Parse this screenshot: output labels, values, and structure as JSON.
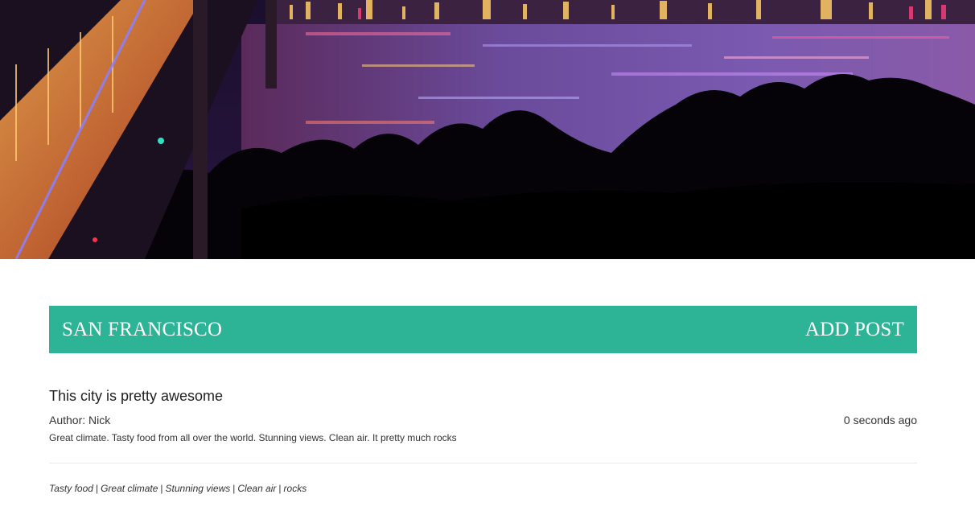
{
  "header": {
    "city": "SAN FRANCISCO",
    "add_post_label": "ADD POST",
    "accent_color": "#2db396"
  },
  "post": {
    "title": "This city is pretty awesome",
    "author_line": "Author: Nick",
    "timestamp": "0 seconds ago",
    "body": "Great climate. Tasty food from all over the world. Stunning views. Clean air. It pretty much rocks"
  },
  "tags": [
    "Tasty food",
    "Great climate",
    "Stunning views",
    "Clean air",
    "rocks"
  ]
}
